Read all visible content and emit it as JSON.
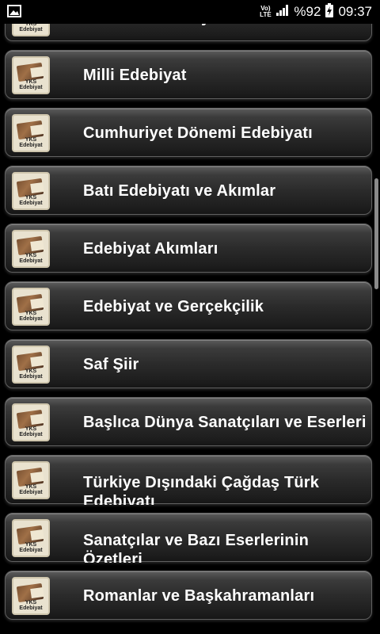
{
  "status_bar": {
    "volte_top": "Vo)",
    "volte_bottom": "LTE",
    "battery": "%92",
    "time": "09:37"
  },
  "icon_caption": "YKS Edebiyat",
  "items": [
    {
      "title": "Fecr-i Ati Edebiyatı"
    },
    {
      "title": "Milli Edebiyat"
    },
    {
      "title": "Cumhuriyet Dönemi Edebiyatı"
    },
    {
      "title": "Batı Edebiyatı ve Akımlar"
    },
    {
      "title": "Edebiyat Akımları"
    },
    {
      "title": "Edebiyat ve Gerçekçilik"
    },
    {
      "title": "Saf Şiir"
    },
    {
      "title": "Başlıca Dünya Sanatçıları ve Eserleri"
    },
    {
      "title": "Türkiye Dışındaki Çağdaş Türk Edebiyatı"
    },
    {
      "title": "Sanatçılar ve Bazı Eserlerinin Özetleri"
    },
    {
      "title": "Romanlar ve Başkahramanları"
    }
  ]
}
